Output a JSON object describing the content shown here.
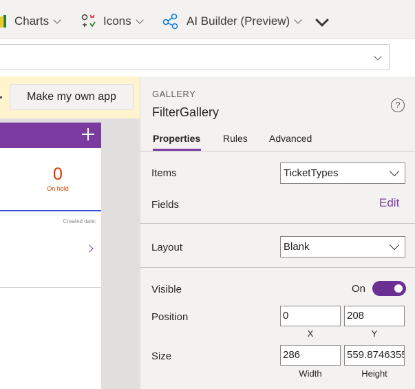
{
  "ribbon": {
    "charts_label": "Charts",
    "icons_label": "Icons",
    "ai_builder_label": "AI Builder (Preview)"
  },
  "formula_bar": {
    "value": ""
  },
  "canvas": {
    "make_app_label": "Make my own app",
    "on_hold_count": "0",
    "on_hold_label": "On hold",
    "created_date_label": "Created date:"
  },
  "panel": {
    "control_type": "GALLERY",
    "control_name": "FilterGallery",
    "help_glyph": "?",
    "tabs": [
      {
        "label": "Properties",
        "active": true
      },
      {
        "label": "Rules",
        "active": false
      },
      {
        "label": "Advanced",
        "active": false
      }
    ],
    "items_label": "Items",
    "items_value": "TicketTypes",
    "fields_label": "Fields",
    "fields_edit": "Edit",
    "layout_label": "Layout",
    "layout_value": "Blank",
    "visible_label": "Visible",
    "visible_state": "On",
    "position_label": "Position",
    "position_x": "0",
    "position_y": "208",
    "x_caption": "X",
    "y_caption": "Y",
    "size_label": "Size",
    "size_width": "286",
    "size_height": "559.8746355",
    "width_caption": "Width",
    "height_caption": "Height"
  },
  "colors": {
    "accent_purple": "#7a3aa0",
    "toggle_on": "#6b2f93",
    "on_hold_orange": "#d83b01",
    "banner_yellow": "#fff4ce"
  }
}
